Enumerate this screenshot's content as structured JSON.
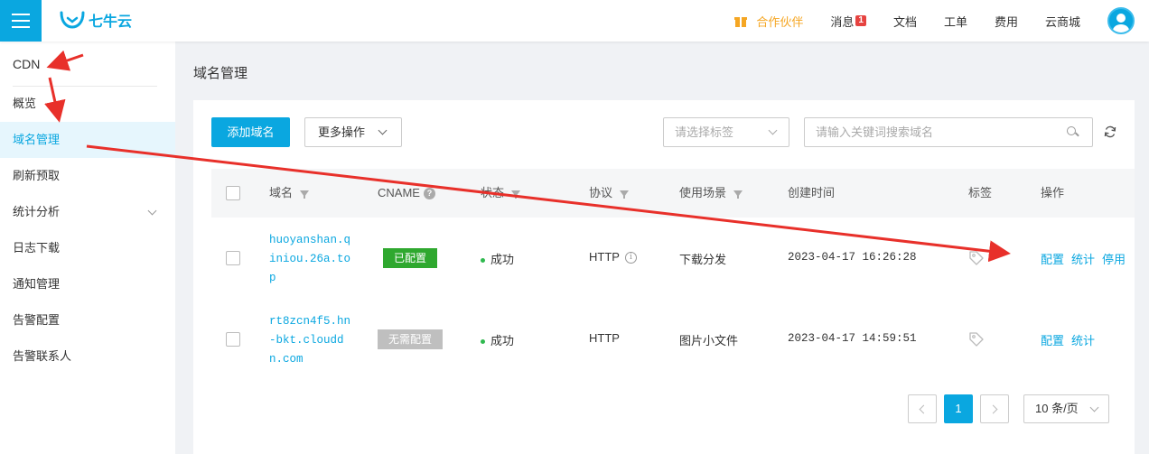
{
  "header": {
    "logo_text": "七牛云",
    "nav": {
      "partner": "合作伙伴",
      "messages": "消息",
      "messages_badge": "1",
      "docs": "文档",
      "tickets": "工单",
      "billing": "费用",
      "marketplace": "云商城"
    }
  },
  "sidebar": {
    "title": "CDN",
    "items": [
      {
        "label": "概览"
      },
      {
        "label": "域名管理",
        "active": true
      },
      {
        "label": "刷新预取"
      },
      {
        "label": "统计分析",
        "expandable": true
      },
      {
        "label": "日志下载"
      },
      {
        "label": "通知管理"
      },
      {
        "label": "告警配置"
      },
      {
        "label": "告警联系人"
      }
    ]
  },
  "main": {
    "page_title": "域名管理",
    "toolbar": {
      "add_domain": "添加域名",
      "more_actions": "更多操作",
      "tag_select_placeholder": "请选择标签",
      "search_placeholder": "请输入关键词搜索域名"
    },
    "table": {
      "columns": {
        "domain": "域名",
        "cname": "CNAME",
        "status": "状态",
        "protocol": "协议",
        "scenario": "使用场景",
        "created": "创建时间",
        "tags": "标签",
        "actions": "操作"
      },
      "rows": [
        {
          "domain": "huoyanshan.qiniou.26a.top",
          "cname_status": "已配置",
          "status": "成功",
          "protocol": "HTTP",
          "scenario": "下载分发",
          "created": "2023-04-17 16:26:28",
          "actions": [
            "配置",
            "统计",
            "停用"
          ]
        },
        {
          "domain": "rt8zcn4f5.hn-bkt.clouddn.com",
          "cname_status": "无需配置",
          "status": "成功",
          "protocol": "HTTP",
          "scenario": "图片小文件",
          "created": "2023-04-17 14:59:51",
          "actions": [
            "配置",
            "统计"
          ]
        }
      ]
    },
    "pagination": {
      "current_page": "1",
      "page_size": "10 条/页"
    }
  },
  "colors": {
    "accent": "#0aa7e0",
    "configured_tag": "#2fa82f",
    "no_config_tag": "#bfbfbf",
    "success_dot": "#2fb94f",
    "annotation_arrow": "#e8302a",
    "partner": "#f5a623"
  }
}
